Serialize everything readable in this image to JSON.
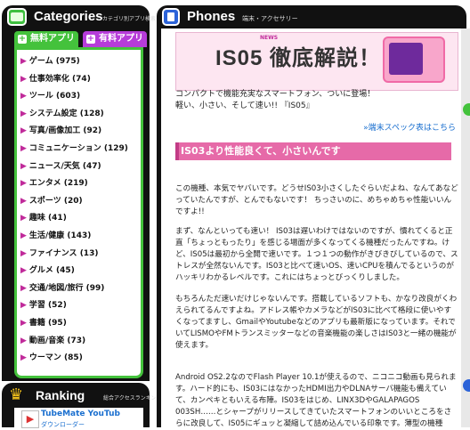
{
  "categories": {
    "title": "Categories",
    "subtitle": "カテゴリ別アプリ検索",
    "tab_free": "無料アプリ",
    "tab_paid": "有料アプリ",
    "items": [
      {
        "label": "ゲーム (975)"
      },
      {
        "label": "仕事効率化 (74)"
      },
      {
        "label": "ツール (603)"
      },
      {
        "label": "システム設定 (128)"
      },
      {
        "label": "写真/画像加工 (92)"
      },
      {
        "label": "コミュニケーション (129)"
      },
      {
        "label": "ニュース/天気 (47)"
      },
      {
        "label": "エンタメ (219)"
      },
      {
        "label": "スポーツ (20)"
      },
      {
        "label": "趣味 (41)"
      },
      {
        "label": "生活/健康 (143)"
      },
      {
        "label": "ファイナンス (13)"
      },
      {
        "label": "グルメ (45)"
      },
      {
        "label": "交通/地図/旅行 (99)"
      },
      {
        "label": "学習 (52)"
      },
      {
        "label": "書籍 (95)"
      },
      {
        "label": "動画/音楽 (73)"
      },
      {
        "label": "ウーマン (85)"
      }
    ]
  },
  "ranking": {
    "title": "Ranking",
    "subtitle": "総合アクセスランキング",
    "item1": "TubeMate YouTub",
    "item1_sub": "ダウンローダー"
  },
  "phones": {
    "title": "Phones",
    "subtitle": "端末・アクセサリー"
  },
  "banner": {
    "news": "NEWS",
    "text": "IS05 徹底解説！"
  },
  "intro": {
    "line1": "コンパクトで機能充実なスマートフォン、ついに登場！",
    "line2": "軽い、小さい、そして速い!! 『IS05』"
  },
  "spec_link": "»端末スペック表はこちら",
  "section_title": "IS03より性能良くて、小さいんです",
  "paragraphs": [
    "この機種、本気でヤバいです。どうせIS03小さくしたぐらいだよね、なんてあなどっていたんですが、とんでもないです！ ちっさいのに、めちゃめちゃ性能いいんですよ!!",
    "まず、なんといっても速い！ IS03は遅いわけではないのですが、慣れてくると正直「ちょっともったり」を感じる場面が多くなってくる機種だったんですね。けど、IS05は最初から全開で速いです。１つ１つの動作がきびきびしているので、ストレスが全然ないんです。IS03と比べて速いOS、速いCPUを積んでるというのがハッキリわかるレベルです。これにはちょっとびっくりしました。",
    "もちろんただ速いだけじゃないんです。搭載しているソフトも、かなり改良がくわえられてるんですよね。アドレス帳やカメラなどがIS03に比べて格段に使いやすくなってますし、GmailやYoutubeなどのアプリも最新版になっています。それでいてLISMOやFMトランスミッターなどの音楽機能の楽しさはIS03と一緒の機能が使えます。",
    "Android OS2.2なのでFlash Player 10.1が使えるので、ニコニコ動画も見られます。ハード的にも、IS03にはなかったHDMI出力やDLNAサーバ機能も備えていて、カンペキともいえる布陣。IS03をはじめ、LINX3DやGALAPAGOS 003SH……とシャープがリリースしてきていたスマートフォンのいいところをさらに改良して、IS05にギュッと凝縮して詰め込んでいる印象です。薄型の機種"
  ]
}
